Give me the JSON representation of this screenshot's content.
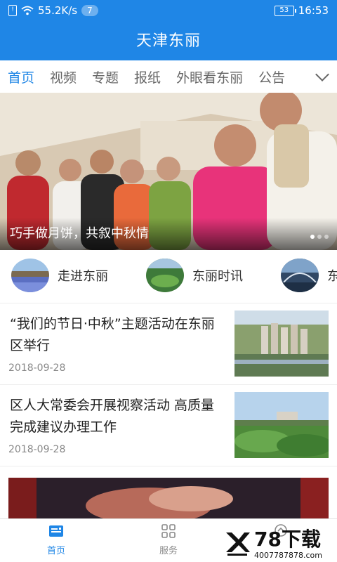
{
  "status_bar": {
    "network_speed": "55.2K/s",
    "notification_count": "7",
    "battery": "53",
    "time": "16:53"
  },
  "app": {
    "title": "天津东丽"
  },
  "tabs": [
    {
      "label": "首页",
      "active": true
    },
    {
      "label": "视频",
      "active": false
    },
    {
      "label": "专题",
      "active": false
    },
    {
      "label": "报纸",
      "active": false
    },
    {
      "label": "外眼看东丽",
      "active": false
    },
    {
      "label": "公告",
      "active": false
    }
  ],
  "banner": {
    "caption": "巧手做月饼，共叙中秋情",
    "slide_count": 3,
    "active_slide": 1
  },
  "channels": [
    {
      "label": "走进东丽",
      "icon": "landscape-flowers-thumbnail"
    },
    {
      "label": "东丽时讯",
      "icon": "park-aerial-thumbnail"
    },
    {
      "label": "东",
      "icon": "bridge-thumbnail"
    }
  ],
  "news": [
    {
      "title": "“我们的节日·中秋”主题活动在东丽区举行",
      "date": "2018-09-28"
    },
    {
      "title": "区人大常委会开展视察活动 高质量完成建议办理工作",
      "date": "2018-09-28"
    }
  ],
  "bottom_nav": [
    {
      "label": "首页",
      "active": true
    },
    {
      "label": "服务",
      "active": false
    },
    {
      "label": "",
      "active": false
    }
  ],
  "watermark": {
    "title": "78下载",
    "url": "4007787878.com"
  },
  "colors": {
    "primary": "#1f86e6",
    "text": "#222222",
    "muted": "#888888"
  }
}
